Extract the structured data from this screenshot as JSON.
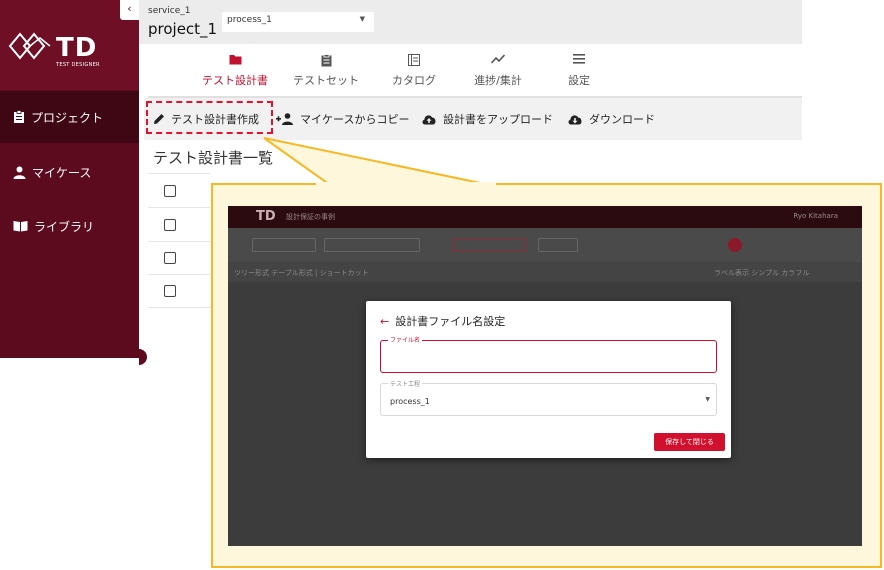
{
  "colors": {
    "sidebar": "#5c0a1e",
    "sidebar_active": "#3f0714",
    "accent": "#c0112f",
    "highlight_dash": "#e3132e",
    "callout_border": "#f6b824",
    "callout_fill": "#fff7db"
  },
  "sidebar": {
    "logo_text": "TD",
    "logo_subtext": "TEST DESIGNER",
    "collapse_glyph": "‹",
    "items": [
      {
        "label": "プロジェクト",
        "icon": "clipboard-icon",
        "active": true
      },
      {
        "label": "マイケース",
        "icon": "person-icon",
        "active": false
      },
      {
        "label": "ライブラリ",
        "icon": "book-icon",
        "active": false
      }
    ]
  },
  "header": {
    "service": "service_1",
    "project": "project_1",
    "process_select": "process_1",
    "select_arrow": "▼"
  },
  "tabs": [
    {
      "label": "テスト設計書",
      "icon": "folder-icon",
      "active": true
    },
    {
      "label": "テストセット",
      "icon": "clipboard-icon",
      "active": false
    },
    {
      "label": "カタログ",
      "icon": "catalog-icon",
      "active": false
    },
    {
      "label": "進捗/集計",
      "icon": "trend-icon",
      "active": false
    },
    {
      "label": "設定",
      "icon": "menu-icon",
      "active": false
    }
  ],
  "toolbar": {
    "create": "テスト設計書作成",
    "copy": "マイケースからコピー",
    "upload": "設計書をアップロード",
    "download": "ダウンロード"
  },
  "list": {
    "title": "テスト設計書一覧"
  },
  "callout": {
    "bg_app_title": "TD",
    "bg_header_title": "設計保証の事例",
    "bg_user": "Ryo Kitahara",
    "bg_toolbar_text": "ツリー形式  テーブル形式  |  ショートカット",
    "bg_right_text": "ラベル表示  シンプル  カラフル",
    "dialog": {
      "back_glyph": "←",
      "title": "設計書ファイル名設定",
      "filename_label": "ファイル名",
      "filename_value": "",
      "process_label": "テスト工程",
      "process_value": "process_1",
      "process_arrow": "▼",
      "save_button": "保存して閉じる"
    }
  }
}
